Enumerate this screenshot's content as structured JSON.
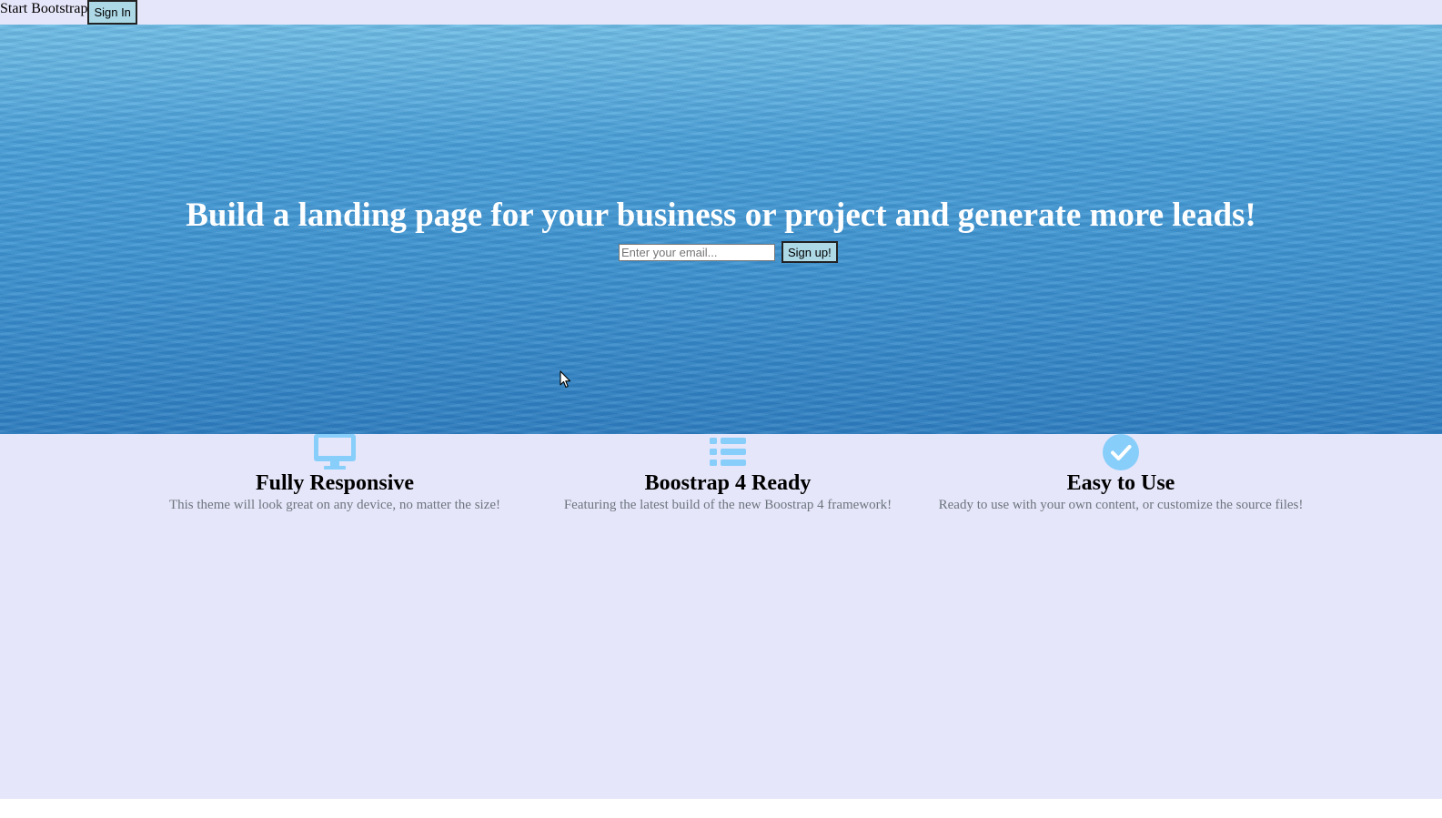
{
  "nav": {
    "brand": "Start Bootstrap",
    "signin_label": "Sign In"
  },
  "hero": {
    "title": "Build a landing page for your business or project and generate more leads!",
    "email_placeholder": "Enter your email...",
    "signup_label": "Sign up!"
  },
  "features": [
    {
      "icon": "desktop-icon",
      "title": "Fully Responsive",
      "text": "This theme will look great on any device, no matter the size!"
    },
    {
      "icon": "list-icon",
      "title": "Boostrap 4 Ready",
      "text": "Featuring the latest build of the new Boostrap 4 framework!"
    },
    {
      "icon": "check-circle-icon",
      "title": "Easy to Use",
      "text": "Ready to use with your own content, or customize the source files!"
    }
  ],
  "colors": {
    "page_background": "#e6e6fa",
    "button_background": "#add8e6",
    "icon_color": "#87cefa",
    "hero_text": "#ffffff",
    "muted_text": "#6c757d"
  }
}
